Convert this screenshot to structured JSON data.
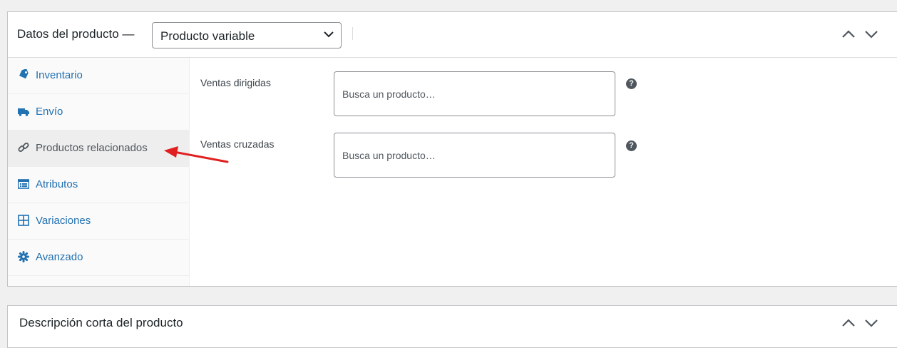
{
  "product_data": {
    "title": "Datos del producto —",
    "product_type": {
      "selected": "Producto variable",
      "icon": "chevron-down-icon"
    },
    "header_buttons": [
      "chevron-up-icon",
      "chevron-down-icon"
    ]
  },
  "tabs": [
    {
      "label": "Inventario",
      "icon": "tag-icon",
      "active": false
    },
    {
      "label": "Envío",
      "icon": "truck-icon",
      "active": false
    },
    {
      "label": "Productos relacionados",
      "icon": "link-icon",
      "active": true
    },
    {
      "label": "Atributos",
      "icon": "list-card-icon",
      "active": false
    },
    {
      "label": "Variaciones",
      "icon": "grid-icon",
      "active": false
    },
    {
      "label": "Avanzado",
      "icon": "gear-icon",
      "active": false
    }
  ],
  "linked_products": {
    "upsells": {
      "label": "Ventas dirigidas",
      "placeholder": "Busca un producto…",
      "help": "?"
    },
    "crosssells": {
      "label": "Ventas cruzadas",
      "placeholder": "Busca un producto…",
      "help": "?"
    }
  },
  "short_description": {
    "title": "Descripción corta del producto"
  },
  "colors": {
    "link": "#2271b1",
    "annotation_arrow": "#e02020"
  }
}
